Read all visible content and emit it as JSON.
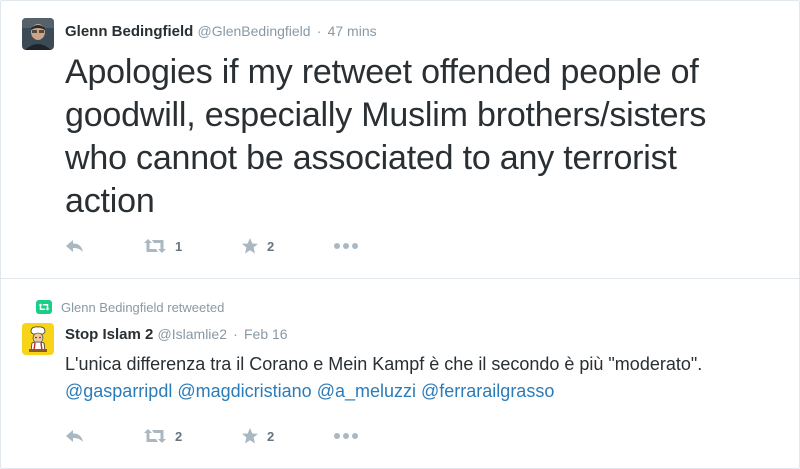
{
  "tweets": [
    {
      "fullname": "Glenn Bedingfield",
      "username": "@GlenBedingfield",
      "separator": "·",
      "time": "47 mins",
      "text": "Apologies if my retweet offended people of goodwill, especially Muslim brothers/sisters who cannot be associated to any terrorist action",
      "retweet_count": "1",
      "favorite_count": "2",
      "colors": {
        "avatar_bg": "#3c4a55"
      }
    },
    {
      "retweeted_by": "Glenn Bedingfield retweeted",
      "fullname": "Stop Islam 2",
      "username": "@Islamlie2",
      "separator": "·",
      "time": "Feb 16",
      "text_plain": "L'unica differenza tra il Corano e Mein Kampf è che il secondo è più \"moderato\".",
      "mentions": [
        "@gasparripdl",
        "@magdicristiano",
        "@a_meluzzi",
        "@ferrarailgrasso"
      ],
      "retweet_count": "2",
      "favorite_count": "2",
      "colors": {
        "avatar_bg": "#f7d417"
      }
    }
  ],
  "colors": {
    "text": "#292f33",
    "muted": "#8899a6",
    "icon": "#aab8c2",
    "link": "#2b7bb9",
    "retweet_badge": "#19cf86",
    "border": "#e1e8ed"
  },
  "icons": [
    "reply-icon",
    "retweet-icon",
    "favorite-star-icon",
    "more-dots-icon",
    "retweeted-badge-icon"
  ]
}
